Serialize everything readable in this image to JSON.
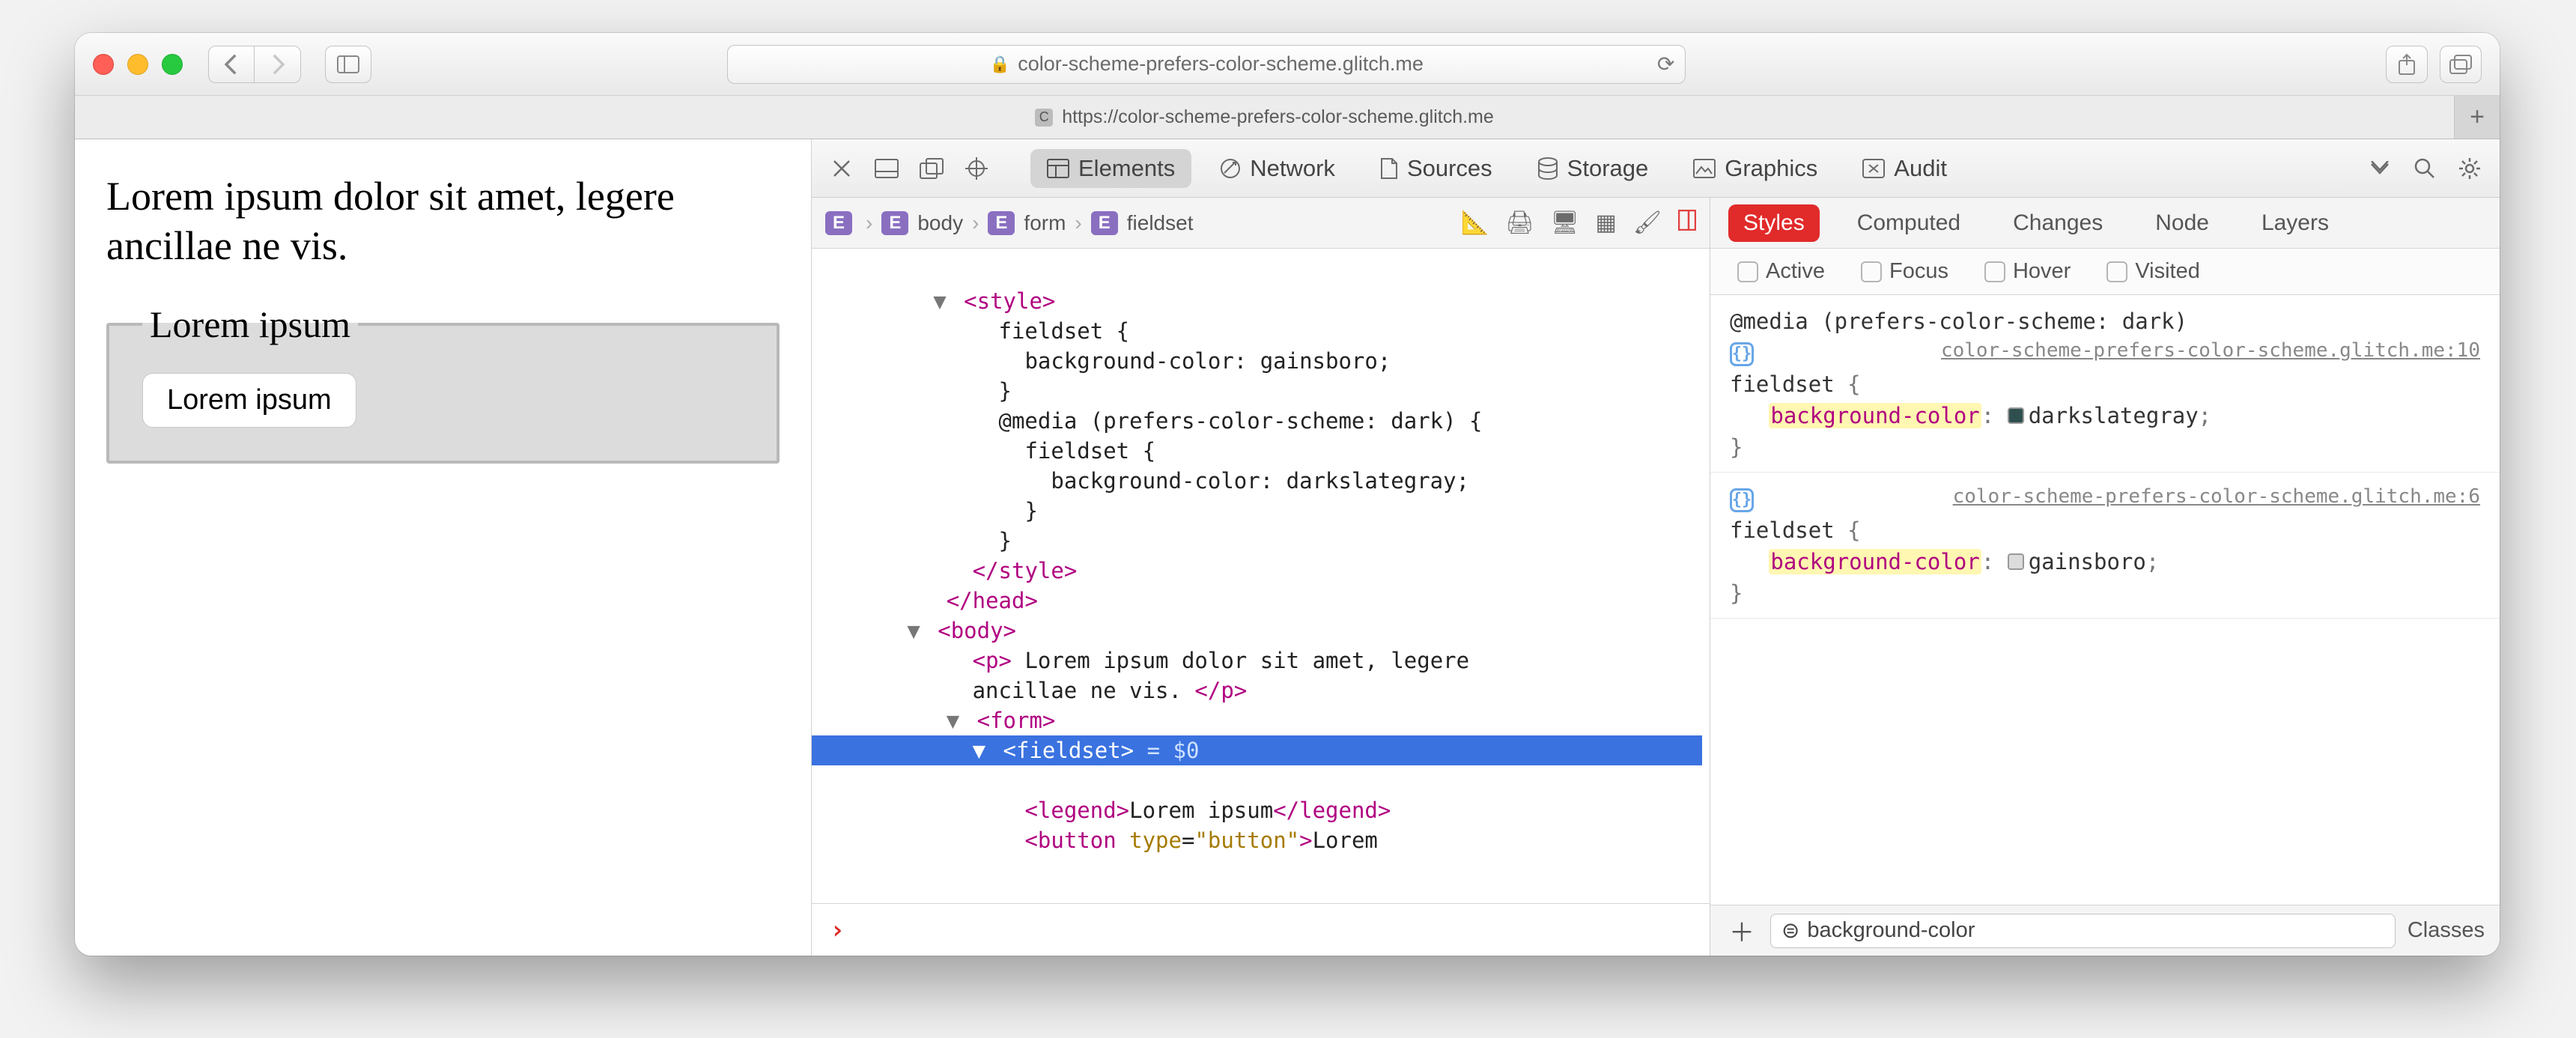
{
  "titlebar": {
    "url_host": "color-scheme-prefers-color-scheme.glitch.me"
  },
  "tab": {
    "label": "https://color-scheme-prefers-color-scheme.glitch.me"
  },
  "page": {
    "paragraph": "Lorem ipsum dolor sit amet, legere ancillae ne vis.",
    "legend": "Lorem ipsum",
    "button": "Lorem ipsum"
  },
  "devtools": {
    "tabs": {
      "elements": "Elements",
      "network": "Network",
      "sources": "Sources",
      "storage": "Storage",
      "graphics": "Graphics",
      "audit": "Audit"
    },
    "breadcrumb": [
      "body",
      "form",
      "fieldset"
    ],
    "dom": {
      "style_open": "<style>",
      "rule1_sel": "fieldset {",
      "rule1_prop": "background-color: gainsboro;",
      "rule1_close": "}",
      "media_open": "@media (prefers-color-scheme: dark) {",
      "rule2_sel": "fieldset {",
      "rule2_prop": "background-color: darkslategray;",
      "rule2_close": "}",
      "media_close": "}",
      "style_close": "</style>",
      "head_close": "</head>",
      "body_open": "<body>",
      "p_line": "<p> Lorem ipsum dolor sit amet, legere ancillae ne vis. </p>",
      "form_open": "<form>",
      "fieldset_sel": "<fieldset>",
      "dollar": " = $0",
      "legend_line": "<legend>Lorem ipsum</legend>",
      "button_line": "<button type=\"button\">Lorem"
    },
    "styles_tabs": {
      "styles": "Styles",
      "computed": "Computed",
      "changes": "Changes",
      "node": "Node",
      "layers": "Layers"
    },
    "pseudo": {
      "active": "Active",
      "focus": "Focus",
      "hover": "Hover",
      "visited": "Visited"
    },
    "rules": {
      "media": "@media (prefers-color-scheme: dark)",
      "src1": "color-scheme-prefers-color-scheme.glitch.me:10",
      "sel": "fieldset",
      "prop": "background-color",
      "val1": "darkslategray",
      "src2": "color-scheme-prefers-color-scheme.glitch.me:6",
      "val2": "gainsboro"
    },
    "filter": {
      "value": "background-color",
      "classes": "Classes"
    }
  }
}
